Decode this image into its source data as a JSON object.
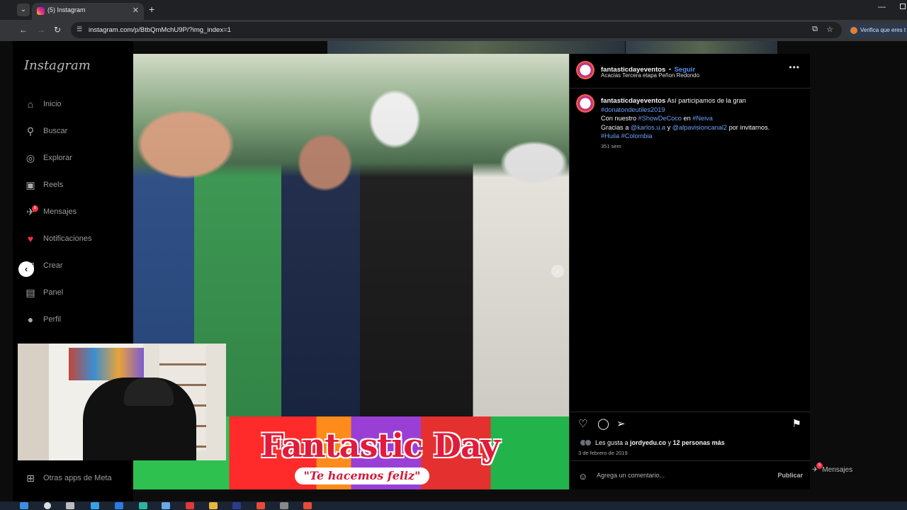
{
  "browser": {
    "tab_title": "(5) Instagram",
    "url": "instagram.com/p/BtbQmMchU9P/?img_index=1",
    "extension_chip": "Verifica que eres t"
  },
  "sidebar": {
    "logo": "Instagram",
    "items": [
      {
        "label": "Inicio",
        "icon": "home-icon"
      },
      {
        "label": "Buscar",
        "icon": "search-icon"
      },
      {
        "label": "Explorar",
        "icon": "compass-icon"
      },
      {
        "label": "Reels",
        "icon": "reels-icon"
      },
      {
        "label": "Mensajes",
        "icon": "messenger-icon",
        "badge": "5"
      },
      {
        "label": "Notificaciones",
        "icon": "heart-icon"
      },
      {
        "label": "Crear",
        "icon": "plus-square-icon"
      },
      {
        "label": "Panel",
        "icon": "chart-icon"
      },
      {
        "label": "Perfil",
        "icon": "avatar-icon"
      }
    ],
    "meta_label": "Otras apps de Meta"
  },
  "post": {
    "banner_title": "Fantastic Day",
    "banner_subtitle": "\"Te hacemos feliz\"",
    "username": "fantasticdayeventos",
    "separator": "•",
    "follow_label": "Seguir",
    "location": "Acacias Tercera etapa Peñon Redondo",
    "caption": {
      "line1_text": " Así participamos de la gran",
      "line2_tag": "#donatondeutiles2019",
      "line3_a": "Con nuestro ",
      "line3_tag1": "#ShowDeCoco",
      "line3_b": " en ",
      "line3_tag2": "#Neiva",
      "line4_a": "Gracias a ",
      "line4_tag1": "@karlos.u.a",
      "line4_b": " y ",
      "line4_tag2": "@alpavisioncanal2",
      "line4_c": " por invitarnos.",
      "line5_tag1": "#Huila",
      "line5_tag2": "#Colombia"
    },
    "time_ago": "351 sem",
    "likes_prefix": "Les gusta a ",
    "likes_user": "jordyedu.co",
    "likes_mid": " y ",
    "likes_count": "12 personas más",
    "date": "3 de febrero de 2019",
    "comment_placeholder": "Agrega un comentario...",
    "publish_label": "Publicar"
  },
  "overlay": {
    "messages_label": "Mensajes",
    "messages_badge": "5"
  },
  "colors": {
    "link": "#4f8ff7",
    "hashtag": "#6fa0f5",
    "notification": "#ff3040"
  }
}
